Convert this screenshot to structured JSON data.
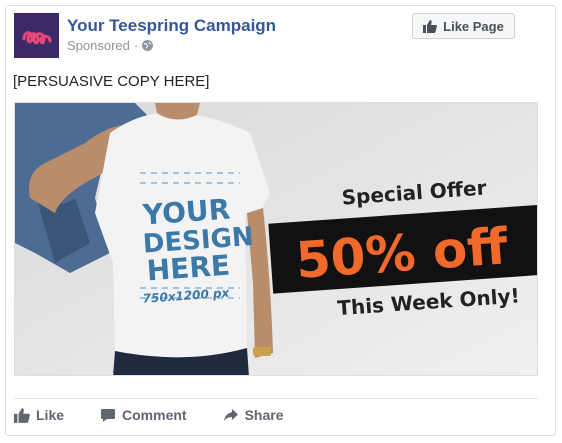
{
  "post": {
    "page_name": "Your Teespring Campaign",
    "sponsored_label": "Sponsored",
    "separator": "·",
    "like_page_label": "Like Page",
    "copy": "[PERSUASIVE COPY HERE]"
  },
  "ad_image": {
    "shirt_line1": "YOUR",
    "shirt_line2": "DESIGN",
    "shirt_line3": "HERE",
    "shirt_size": "750x1200 px",
    "banner_top": "Special Offer",
    "banner_main": "50% off",
    "banner_bottom": "This Week Only!"
  },
  "actions": {
    "like": "Like",
    "comment": "Comment",
    "share": "Share"
  },
  "colors": {
    "link_blue": "#365899",
    "avatar_bg": "#3b2a66",
    "avatar_logo": "#e8477a",
    "offer_orange": "#f26a2b",
    "shirt_text": "#3b79a8"
  },
  "icons": {
    "avatar": "teespring-logo",
    "privacy": "globe-icon",
    "like_page": "thumbs-up-icon",
    "like": "thumbs-up-icon",
    "comment": "comment-icon",
    "share": "share-arrow-icon"
  }
}
